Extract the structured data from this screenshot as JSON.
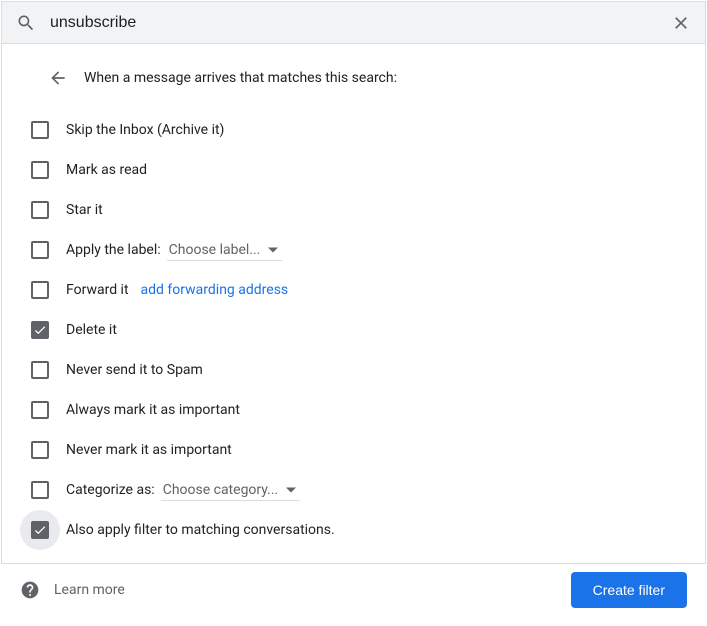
{
  "search": {
    "value": "unsubscribe"
  },
  "header": {
    "text": "When a message arrives that matches this search:"
  },
  "options": {
    "skip_inbox": "Skip the Inbox (Archive it)",
    "mark_read": "Mark as read",
    "star": "Star it",
    "apply_label": "Apply the label:",
    "apply_label_dropdown": "Choose label...",
    "forward": "Forward it",
    "forward_link": "add forwarding address",
    "delete": "Delete it",
    "never_spam": "Never send it to Spam",
    "always_important": "Always mark it as important",
    "never_important": "Never mark it as important",
    "categorize": "Categorize as:",
    "categorize_dropdown": "Choose category...",
    "also_apply": "Also apply filter to matching conversations."
  },
  "footer": {
    "learn_more": "Learn more",
    "create": "Create filter"
  }
}
